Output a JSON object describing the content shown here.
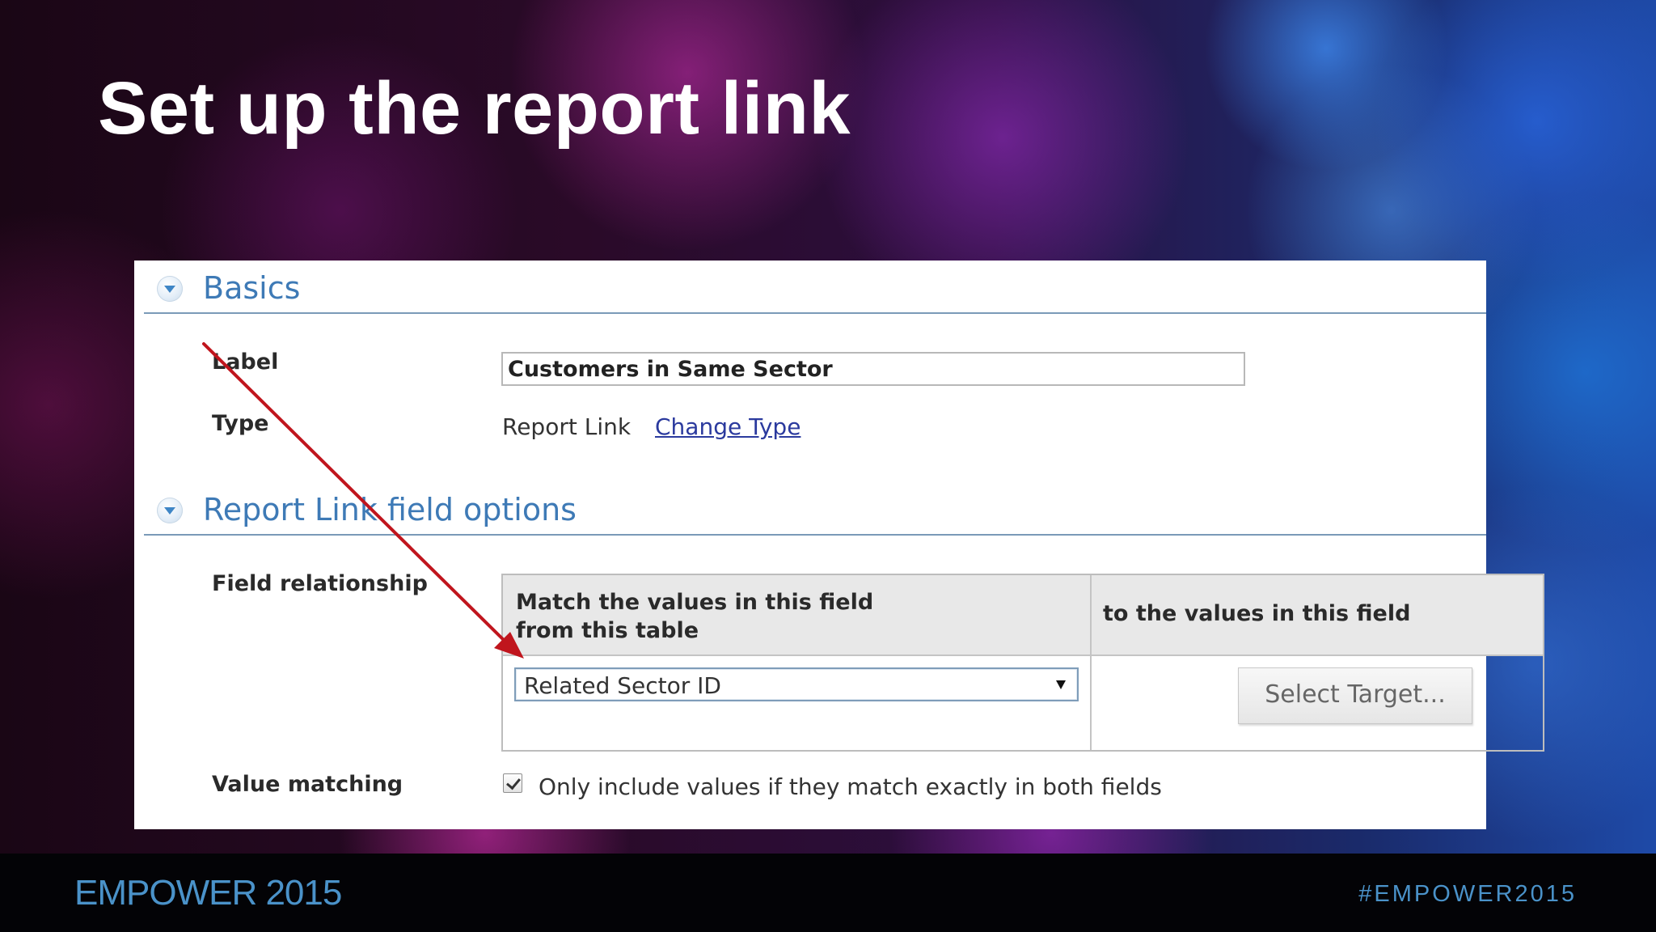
{
  "slide": {
    "title": "Set up the report link"
  },
  "basics": {
    "heading": "Basics",
    "label_caption": "Label",
    "label_value": "Customers in Same Sector",
    "type_caption": "Type",
    "type_value": "Report Link",
    "change_type_link": "Change Type"
  },
  "options": {
    "heading": "Report Link field options",
    "field_relationship_caption": "Field relationship",
    "table": {
      "source_header": "Match the values in this field from this table",
      "target_header": "to the values in this field",
      "source_selected": "Related Sector ID",
      "target_button": "Select Target..."
    },
    "value_matching_caption": "Value matching",
    "value_matching_checked": true,
    "value_matching_text": "Only include values if they match exactly in both fields"
  },
  "footer": {
    "brand": "EMPOWER 2015",
    "hashtag": "#EMPOWER2015"
  },
  "colors": {
    "section_heading": "#3e7ab6",
    "link": "#2b3a9e",
    "annotation_arrow": "#c0151d",
    "footer_text": "#4a92c9"
  },
  "icons": {
    "collapse": "collapse-triangle-down",
    "dropdown": "dropdown-arrow",
    "checkbox": "checkmark",
    "annotation": "red-arrow"
  }
}
